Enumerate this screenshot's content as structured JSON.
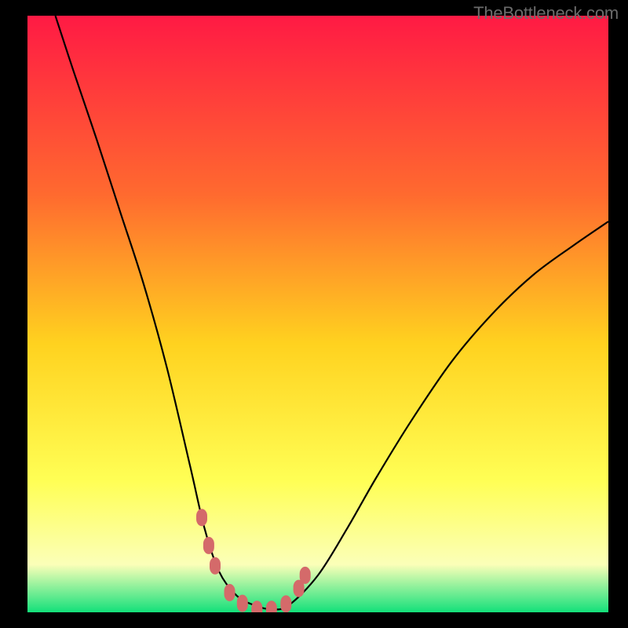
{
  "watermark": "TheBottleneck.com",
  "colors": {
    "frame": "#000000",
    "curve": "#000000",
    "marker": "#d46a6a",
    "grad_top": "#ff1a44",
    "grad_mid1": "#ff6a2f",
    "grad_mid2": "#ffd21f",
    "grad_mid3": "#ffff55",
    "grad_mid4": "#fbffb8",
    "grad_bottom": "#13e07a"
  },
  "chart_data": {
    "type": "line",
    "title": "",
    "xlabel": "",
    "ylabel": "",
    "xlim": [
      0,
      1
    ],
    "ylim": [
      0,
      1
    ],
    "annotations": [],
    "series": [
      {
        "name": "bottleneck-curve",
        "x": [
          0.048,
          0.08,
          0.12,
          0.16,
          0.2,
          0.24,
          0.28,
          0.305,
          0.33,
          0.36,
          0.39,
          0.42,
          0.45,
          0.5,
          0.55,
          0.6,
          0.66,
          0.73,
          0.8,
          0.87,
          0.94,
          1.0
        ],
        "y": [
          1.0,
          0.905,
          0.79,
          0.67,
          0.55,
          0.41,
          0.245,
          0.14,
          0.068,
          0.028,
          0.012,
          0.005,
          0.012,
          0.062,
          0.14,
          0.225,
          0.32,
          0.42,
          0.5,
          0.565,
          0.615,
          0.655
        ]
      },
      {
        "name": "highlight-markers",
        "x": [
          0.3,
          0.312,
          0.323,
          0.348,
          0.37,
          0.395,
          0.42,
          0.445,
          0.467,
          0.478
        ],
        "y": [
          0.159,
          0.112,
          0.078,
          0.033,
          0.015,
          0.005,
          0.005,
          0.014,
          0.04,
          0.062
        ]
      }
    ]
  }
}
